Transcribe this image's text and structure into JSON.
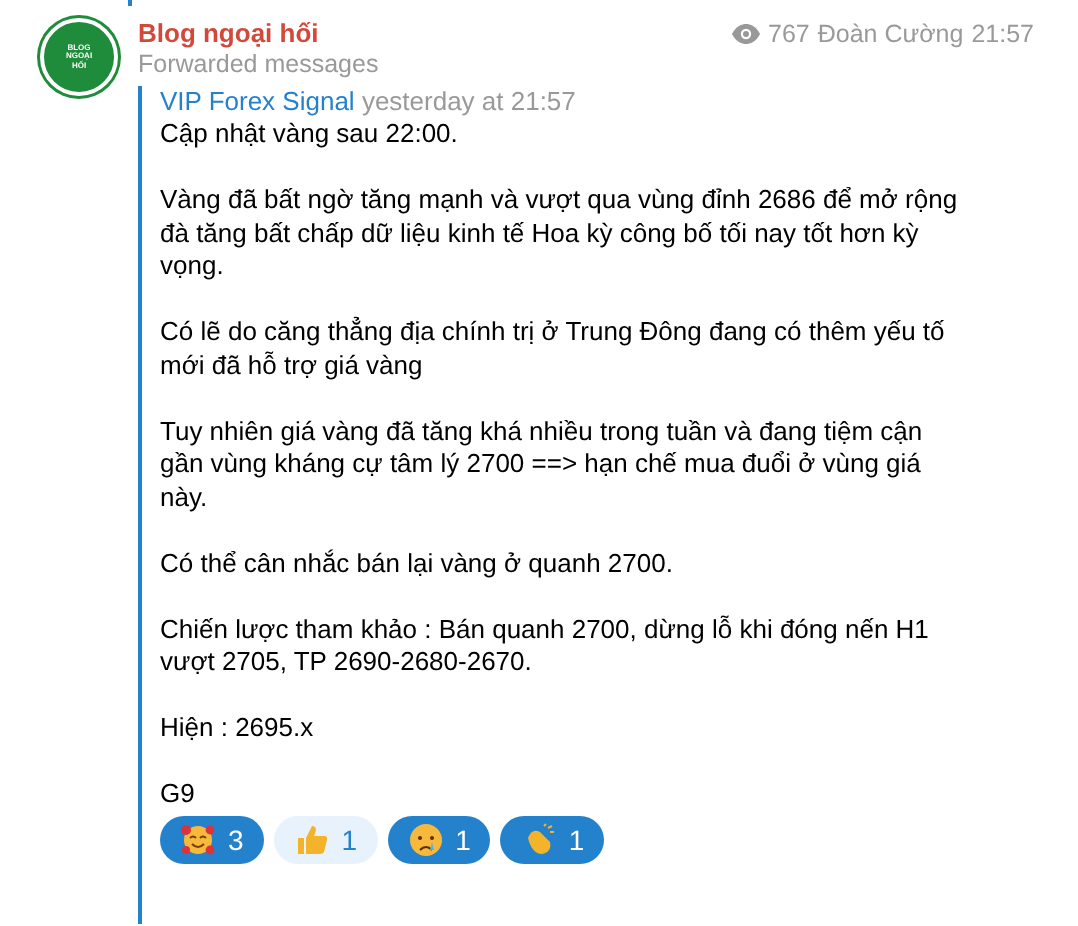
{
  "channel": {
    "name": "Blog ngoại hối",
    "subtitle": "Forwarded messages",
    "avatar_text": "BLOG NGOẠI HỐI",
    "views": "767",
    "author": "Đoàn Cường",
    "time": "21:57"
  },
  "forward": {
    "source": "VIP Forex Signal",
    "date": "yesterday at 21:57"
  },
  "paragraphs": [
    "Cập nhật vàng sau 22:00.",
    "Vàng đã bất ngờ tăng mạnh và vượt qua vùng đỉnh 2686 để mở rộng đà tăng bất chấp dữ liệu kinh tế Hoa kỳ công bố tối nay tốt hơn kỳ vọng.",
    "Có lẽ do căng thẳng địa chính trị ở Trung Đông đang có thêm yếu tố mới đã hỗ trợ giá vàng",
    "Tuy nhiên giá vàng đã tăng khá nhiều trong tuần và đang tiệm cận gần vùng kháng cự tâm lý 2700 ==> hạn chế mua đuổi ở vùng giá này.",
    "Có thể cân nhắc bán lại vàng ở quanh 2700.",
    "Chiến lược tham khảo : Bán quanh 2700, dừng lỗ khi đóng nến H1 vượt 2705, TP 2690-2680-2670.",
    "Hiện : 2695.x",
    "G9"
  ],
  "reactions": [
    {
      "kind": "hearts",
      "count": "3",
      "selected": true
    },
    {
      "kind": "thumbs",
      "count": "1",
      "selected": false
    },
    {
      "kind": "crying",
      "count": "1",
      "selected": true
    },
    {
      "kind": "clap",
      "count": "1",
      "selected": true
    }
  ]
}
